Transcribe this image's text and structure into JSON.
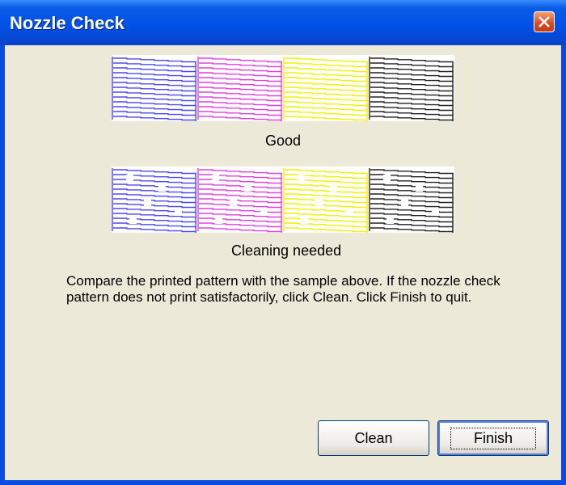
{
  "window": {
    "title": "Nozzle Check"
  },
  "samples": {
    "good_caption": "Good",
    "bad_caption": "Cleaning needed",
    "colors": [
      "#4a4af0",
      "#e040e0",
      "#f2f200",
      "#222222"
    ]
  },
  "instructions": "Compare the printed pattern with the sample above. If the nozzle check pattern does not print satisfactorily, click Clean. Click Finish to quit.",
  "buttons": {
    "clean_label": "Clean",
    "finish_label": "Finish"
  }
}
